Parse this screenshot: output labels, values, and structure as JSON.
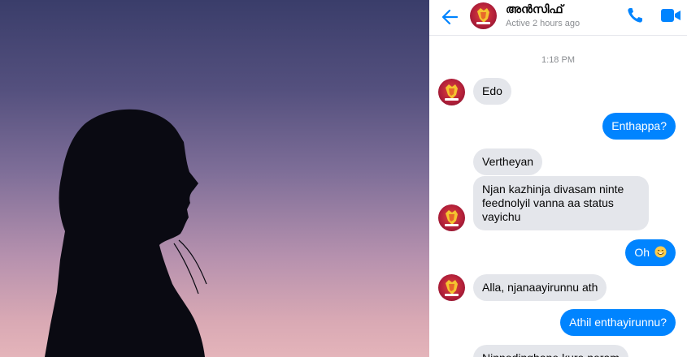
{
  "chat": {
    "contact_name": "അൻസിഫ്",
    "contact_status": "Active 2 hours ago",
    "timestamp": "1:18 PM",
    "messages": [
      {
        "text": "Edo"
      },
      {
        "text": "Enthappa?"
      },
      {
        "text": "Vertheyan"
      },
      {
        "lines": [
          "Njan kazhinja divasam ninte",
          "feednolyil  vanna aa status",
          "vayichu"
        ]
      },
      {
        "text": "Oh"
      },
      {
        "text": "Alla, njanaayirunnu ath"
      },
      {
        "text": "Athil enthayirunnu?"
      },
      {
        "text": "Ninnodinghane kure neram"
      }
    ]
  },
  "colors": {
    "accent": "#0084ff",
    "incoming_bubble": "#e4e6eb",
    "avatar_red": "#b3203a"
  },
  "icons": {
    "back": "arrow-left-icon",
    "call": "phone-icon",
    "video": "video-camera-icon",
    "emoji": "smiling-face-icon"
  }
}
